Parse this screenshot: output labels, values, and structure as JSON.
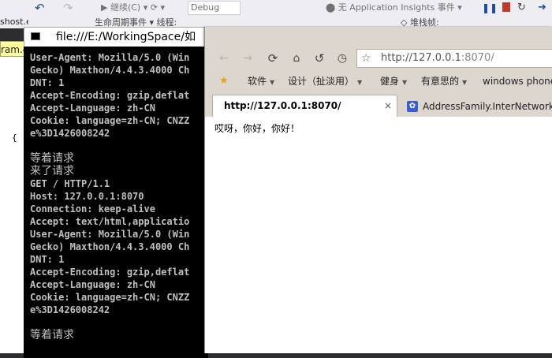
{
  "vs": {
    "undo_icon": "undo-icon",
    "redo_icon": "redo-icon",
    "continue_label": "▶ 继续(C) ▾ ⟳ ▾",
    "config_value": "Debug",
    "lifecycle_label": "生命周期事件 ▾ 线程",
    "ai_label": "⬤ 无 Application Insights 事件 ▾",
    "pause_icon": "pause-icon",
    "stop_icon": "stop-icon",
    "restart_icon": "restart-icon",
    "step_icon": "step-icon",
    "menu_items": [
      "生命周期事件 ▾ 线程:",
      "◇ 堆栈帧:"
    ],
    "tab1_label": "shost.exe",
    "tab2_label": "ram.c",
    "editor_brace": "{"
  },
  "console": {
    "title": "file:///E:/WorkingSpace/如",
    "lines": [
      {
        "text": "User-Agent: Mozilla/5.0 (Win",
        "big": false
      },
      {
        "text": "Gecko) Maxthon/4.4.3.4000 Ch",
        "big": false
      },
      {
        "text": "DNT: 1",
        "big": false
      },
      {
        "text": "Accept-Encoding: gzip,deflat",
        "big": false
      },
      {
        "text": "Accept-Language: zh-CN",
        "big": false
      },
      {
        "text": "Cookie: language=zh-CN; CNZZ",
        "big": false
      },
      {
        "text": "e%3D1426008242",
        "big": false
      },
      {
        "text": "",
        "big": false
      },
      {
        "text": "等着请求",
        "big": true
      },
      {
        "text": "来了请求",
        "big": true
      },
      {
        "text": "GET / HTTP/1.1",
        "big": false
      },
      {
        "text": "Host: 127.0.0.1:8070",
        "big": false
      },
      {
        "text": "Connection: keep-alive",
        "big": false
      },
      {
        "text": "Accept: text/html,applicatio",
        "big": false
      },
      {
        "text": "User-Agent: Mozilla/5.0 (Win",
        "big": false
      },
      {
        "text": "Gecko) Maxthon/4.4.3.4000 Ch",
        "big": false
      },
      {
        "text": "DNT: 1",
        "big": false
      },
      {
        "text": "Accept-Encoding: gzip,deflat",
        "big": false
      },
      {
        "text": "Accept-Language: zh-CN",
        "big": false
      },
      {
        "text": "Cookie: language=zh-CN; CNZZ",
        "big": false
      },
      {
        "text": "e%3D1426008242",
        "big": false
      },
      {
        "text": "",
        "big": false
      },
      {
        "text": "等着请求",
        "big": true
      }
    ]
  },
  "browser": {
    "nav": {
      "back_icon": "back-arrow-icon",
      "forward_icon": "forward-arrow-icon",
      "refresh_icon": "refresh-icon",
      "home_icon": "home-icon",
      "undo_icon": "undo-close-icon",
      "history_icon": "history-clock-icon"
    },
    "address": {
      "host": "http://127.0.0.1",
      "port": ":8070/"
    },
    "bookmarks": [
      {
        "label": "软件",
        "dropdown": true
      },
      {
        "label": "设计（扯淡用）",
        "dropdown": true
      },
      {
        "label": "健身",
        "dropdown": true
      },
      {
        "label": "有意思的",
        "dropdown": true
      },
      {
        "label": "windows phone开",
        "dropdown": false
      }
    ],
    "tabs": [
      {
        "title": "http://127.0.0.1:8070/",
        "active": true,
        "close": "×"
      },
      {
        "title": "AddressFamily.InterNetwork_百",
        "active": false
      }
    ],
    "page_text": "哎呀，你好，你好！"
  }
}
